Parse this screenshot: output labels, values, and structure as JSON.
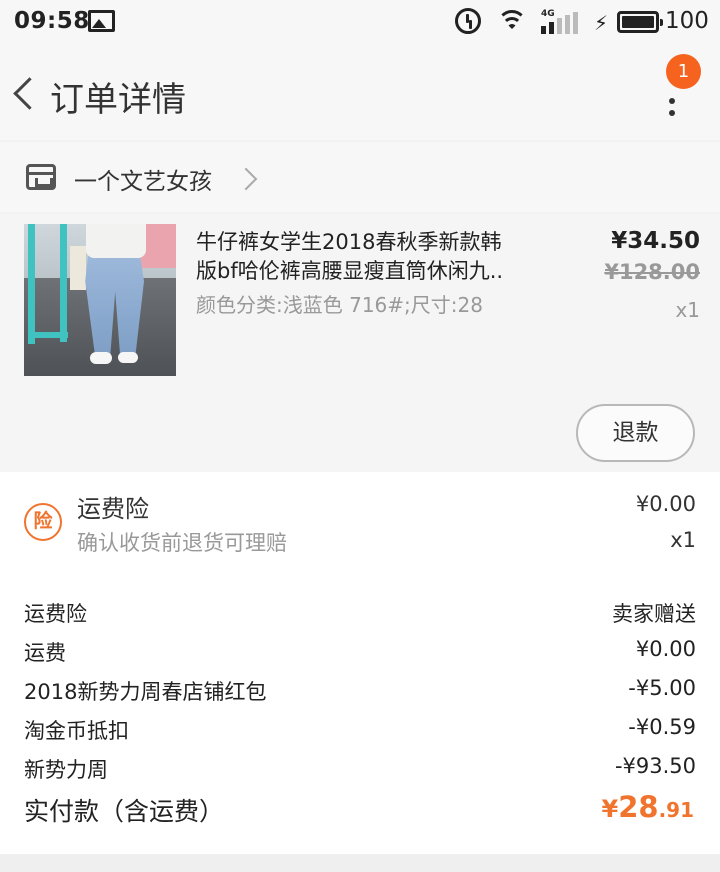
{
  "status_bar": {
    "time": "09:58",
    "network": "4G",
    "battery": "100",
    "icons": [
      "image-icon",
      "alarm-icon",
      "wifi-icon",
      "signal-icon",
      "charging-icon",
      "battery-icon"
    ]
  },
  "header": {
    "title": "订单详情",
    "badge_count": "1"
  },
  "shop": {
    "name": "一个文艺女孩"
  },
  "product": {
    "title_line1": "牛仔裤女学生2018春秋季新款韩",
    "title_line2": "版bf哈伦裤高腰显瘦直筒休闲九..",
    "sku": "颜色分类:浅蓝色 716#;尺寸:28",
    "price": "¥34.50",
    "original_price": "¥128.00",
    "quantity": "x1",
    "refund_label": "退款"
  },
  "insurance": {
    "icon_text": "险",
    "title": "运费险",
    "description": "确认收货前退货可理赔",
    "price": "¥0.00",
    "quantity": "x1"
  },
  "fees": [
    {
      "label": "运费险",
      "value": "卖家赠送"
    },
    {
      "label": "运费",
      "value": "¥0.00"
    },
    {
      "label": "2018新势力周春店铺红包",
      "value": "-¥5.00"
    },
    {
      "label": "淘金币抵扣",
      "value": "-¥0.59"
    },
    {
      "label": "新势力周",
      "value": "-¥93.50"
    }
  ],
  "total": {
    "label": "实付款（含运费）",
    "symbol": "¥",
    "integer": "28",
    "decimal": ".91"
  },
  "colors": {
    "accent": "#f0742e",
    "badge": "#f5631e"
  }
}
